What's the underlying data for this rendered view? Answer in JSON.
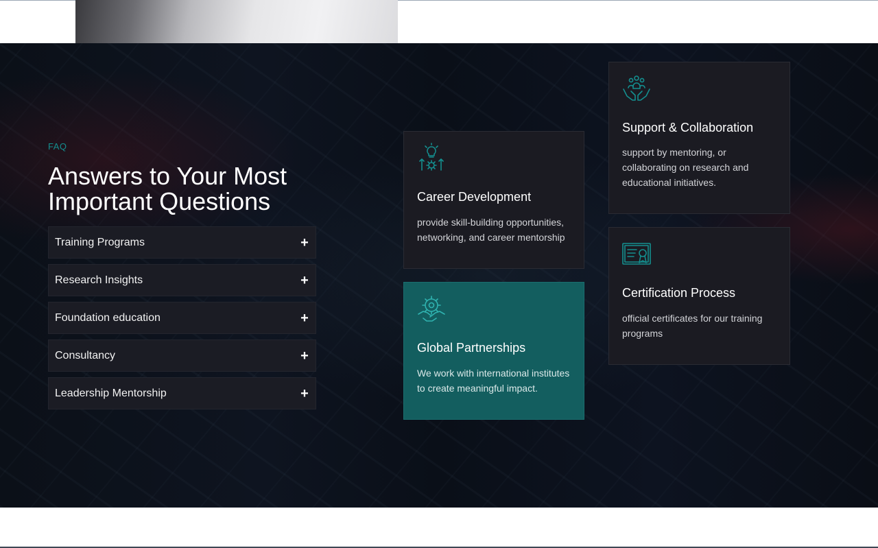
{
  "colors": {
    "accent": "#148f8f",
    "section_bg": "#0b1018",
    "card_bg": "#1b1b22",
    "highlight_card_bg": "#135e5f"
  },
  "faq": {
    "label": "FAQ",
    "title": "Answers to Your Most Important Questions",
    "items": [
      {
        "label": "Training Programs",
        "toggle": "+"
      },
      {
        "label": "Research Insights",
        "toggle": "+"
      },
      {
        "label": "Foundation education",
        "toggle": "+"
      },
      {
        "label": "Consultancy",
        "toggle": "+"
      },
      {
        "label": "Leadership Mentorship",
        "toggle": "+"
      }
    ]
  },
  "cards": {
    "career": {
      "icon": "lightbulb-gear-icon",
      "title": "Career Development",
      "desc": "provide skill-building opportunities, networking, and career mentorship"
    },
    "partnerships": {
      "icon": "handshake-gear-icon",
      "title": "Global Partnerships",
      "desc": "We work with international institutes to create meaningful impact."
    },
    "support": {
      "icon": "hands-people-icon",
      "title": "Support & Collaboration",
      "desc": "support by mentoring, or collaborating on research and educational initiatives."
    },
    "certification": {
      "icon": "certificate-icon",
      "title": "Certification Process",
      "desc": "official certificates for our training programs"
    }
  }
}
